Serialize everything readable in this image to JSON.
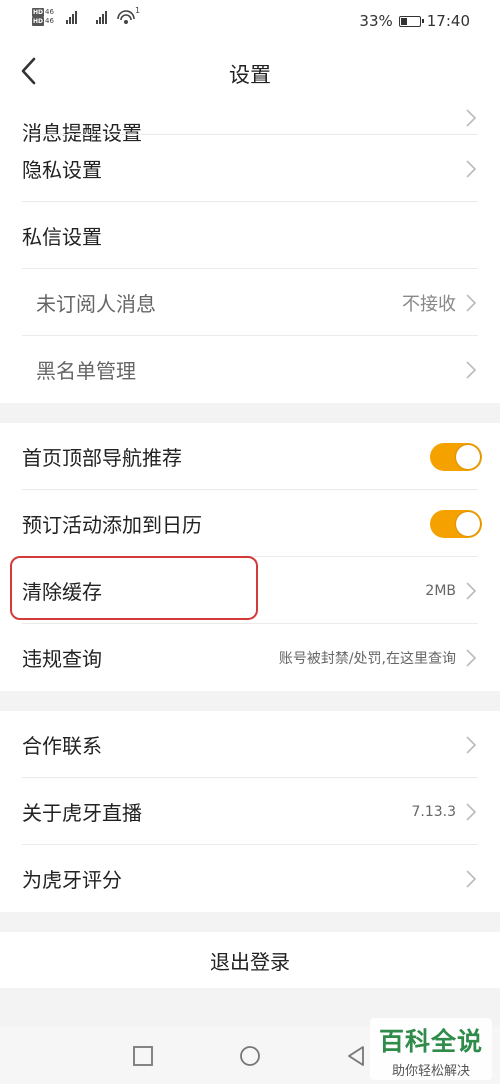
{
  "status_bar": {
    "sim1_badge": "HD",
    "sim2_badge": "HD",
    "sim1_net": "46",
    "sim2_net": "46",
    "hotspot_count": "1",
    "battery": "33%",
    "time": "17:40"
  },
  "header": {
    "title": "设置"
  },
  "settings": {
    "message_notify": {
      "label": "消息提醒设置"
    },
    "privacy": {
      "label": "隐私设置"
    },
    "private_message": {
      "label": "私信设置"
    },
    "unsubscribed_msg": {
      "label": "未订阅人消息",
      "value": "不接收"
    },
    "blacklist": {
      "label": "黑名单管理"
    },
    "homepage_nav": {
      "label": "首页顶部导航推荐",
      "enabled": true
    },
    "calendar": {
      "label": "预订活动添加到日历",
      "enabled": true
    },
    "clear_cache": {
      "label": "清除缓存",
      "value": "2MB"
    },
    "violation": {
      "label": "违规查询",
      "value": "账号被封禁/处罚,在这里查询"
    },
    "cooperation": {
      "label": "合作联系"
    },
    "about": {
      "label": "关于虎牙直播",
      "value": "7.13.3"
    },
    "rate": {
      "label": "为虎牙评分"
    }
  },
  "logout": {
    "label": "退出登录"
  },
  "colors": {
    "accent": "#f5a100",
    "highlight": "#d43a3a",
    "watermark": "#2e8b4a"
  },
  "watermark": {
    "title": "百科全说",
    "subtitle": "助你轻松解决"
  }
}
